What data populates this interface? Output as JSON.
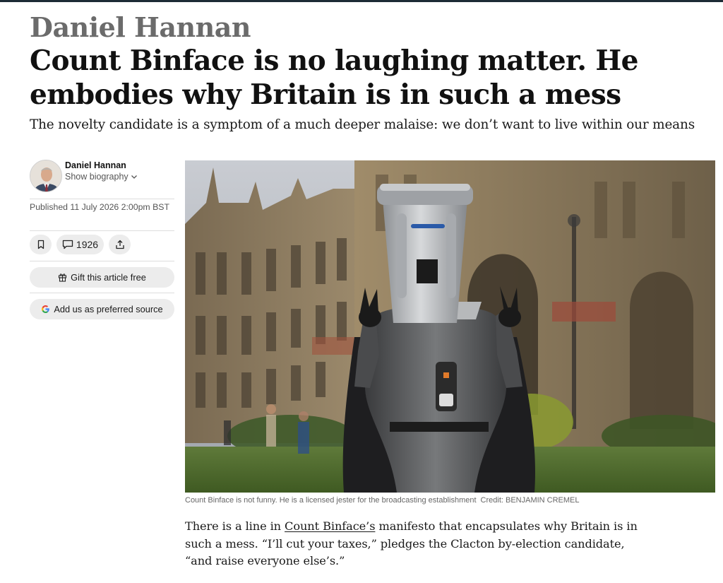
{
  "article": {
    "kicker": "Daniel Hannan",
    "headline": "Count Binface is no laughing matter. He embodies why Britain is in such a mess",
    "standfirst": "The novelty candidate is a symptom of a much deeper malaise: we don’t want to live within our means"
  },
  "author": {
    "name": "Daniel Hannan",
    "bio_toggle": "Show biography",
    "bio_icon": "chevron-down-icon"
  },
  "published": "Published 11 July 2026 2:00pm BST",
  "actions": {
    "save_icon": "bookmark-icon",
    "comment_icon": "comment-icon",
    "comment_count": "1926",
    "share_icon": "share-icon",
    "gift_icon": "gift-icon",
    "gift_label": "Gift this article free",
    "source_icon": "google-g-icon",
    "source_label": "Add us as preferred source"
  },
  "image": {
    "caption": "Count Binface is not funny. He is a licensed jester for the broadcasting establishment",
    "credit": "Credit: BENJAMIN CREMEL"
  },
  "body": {
    "before_link": "There is a line in ",
    "link_text": "Count Binface’s",
    "after_link": " manifesto that encapsulates why Britain is in such a mess. “I’ll cut your taxes,” pledges the Clacton by-election candidate, “and raise everyone else’s.”"
  },
  "colors": {
    "kicker": "#6b6b6b",
    "headline": "#111111",
    "pill_background": "#ececec",
    "top_rule": "#1d2b36"
  }
}
